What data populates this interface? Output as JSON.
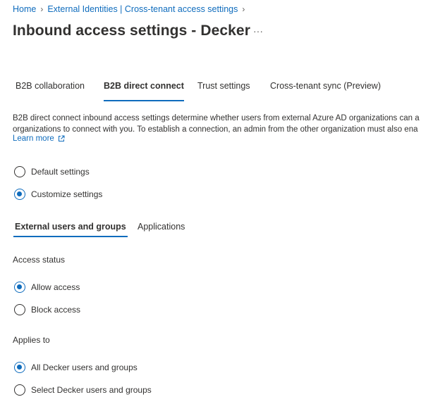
{
  "breadcrumb": {
    "home": "Home",
    "item1": "External Identities | Cross-tenant access settings"
  },
  "title": "Inbound access settings - Decker",
  "more_label": "···",
  "tabs": [
    {
      "label": "B2B collaboration",
      "active": false
    },
    {
      "label": "B2B direct connect",
      "active": true
    },
    {
      "label": "Trust settings",
      "active": false
    },
    {
      "label": "Cross-tenant sync (Preview)",
      "active": false
    }
  ],
  "description": {
    "line1": "B2B direct connect inbound access settings determine whether users from external Azure AD organizations can a",
    "line2": "organizations to connect with you. To establish a connection, an admin from the other organization must also ena"
  },
  "learn_more": "Learn more",
  "settings_mode": {
    "options": [
      {
        "label": "Default settings",
        "selected": false
      },
      {
        "label": "Customize settings",
        "selected": true
      }
    ]
  },
  "subtabs": [
    {
      "label": "External users and groups",
      "active": true
    },
    {
      "label": "Applications",
      "active": false
    }
  ],
  "access_status": {
    "label": "Access status",
    "options": [
      {
        "label": "Allow access",
        "selected": true
      },
      {
        "label": "Block access",
        "selected": false
      }
    ]
  },
  "applies_to": {
    "label": "Applies to",
    "options": [
      {
        "label": "All Decker users and groups",
        "selected": true
      },
      {
        "label": "Select Decker users and groups",
        "selected": false
      }
    ]
  },
  "colors": {
    "accent": "#0f6cbd",
    "text": "#323130"
  }
}
